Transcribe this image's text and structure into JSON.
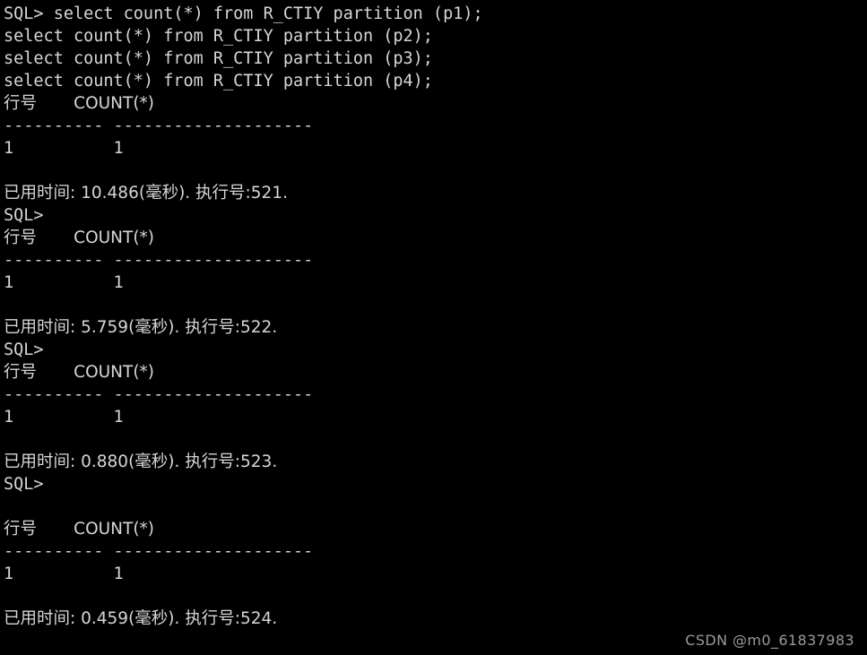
{
  "terminal": {
    "title": "SQL Terminal",
    "background_color": "#000000",
    "text_color": "#d6d6d6",
    "prompt": "SQL>",
    "lines": [
      {
        "id": "cmd-1",
        "text": "SQL> select count(*) from R_CTIY partition (p1);",
        "kind": "command"
      },
      {
        "id": "cmd-2",
        "text": "select count(*) from R_CTIY partition (p2);",
        "kind": "command"
      },
      {
        "id": "cmd-3",
        "text": "select count(*) from R_CTIY partition (p3);",
        "kind": "command"
      },
      {
        "id": "cmd-4",
        "text": "select count(*) from R_CTIY partition (p4);",
        "kind": "command"
      },
      {
        "id": "header-1",
        "text": "行号       COUNT(*)",
        "kind": "header"
      },
      {
        "id": "sep-1",
        "text": "---------- --------------------",
        "kind": "separator"
      },
      {
        "id": "row-1",
        "text": "1          1",
        "kind": "row"
      },
      {
        "id": "blank-1",
        "text": " ",
        "kind": "blank"
      },
      {
        "id": "elapsed-1",
        "text": "已用时间: 10.486(毫秒). 执行号:521.",
        "kind": "status"
      },
      {
        "id": "prompt-1",
        "text": "SQL>",
        "kind": "prompt"
      },
      {
        "id": "header-2",
        "text": "行号       COUNT(*)",
        "kind": "header"
      },
      {
        "id": "sep-2",
        "text": "---------- --------------------",
        "kind": "separator"
      },
      {
        "id": "row-2",
        "text": "1          1",
        "kind": "row"
      },
      {
        "id": "blank-2",
        "text": " ",
        "kind": "blank"
      },
      {
        "id": "elapsed-2",
        "text": "已用时间: 5.759(毫秒). 执行号:522.",
        "kind": "status"
      },
      {
        "id": "prompt-2",
        "text": "SQL>",
        "kind": "prompt"
      },
      {
        "id": "header-3",
        "text": "行号       COUNT(*)",
        "kind": "header"
      },
      {
        "id": "sep-3",
        "text": "---------- --------------------",
        "kind": "separator"
      },
      {
        "id": "row-3",
        "text": "1          1",
        "kind": "row"
      },
      {
        "id": "blank-3",
        "text": " ",
        "kind": "blank"
      },
      {
        "id": "elapsed-3",
        "text": "已用时间: 0.880(毫秒). 执行号:523.",
        "kind": "status"
      },
      {
        "id": "prompt-3",
        "text": "SQL>",
        "kind": "prompt"
      },
      {
        "id": "blank-4",
        "text": " ",
        "kind": "blank"
      },
      {
        "id": "header-4",
        "text": "行号       COUNT(*)",
        "kind": "header"
      },
      {
        "id": "sep-4",
        "text": "---------- --------------------",
        "kind": "separator"
      },
      {
        "id": "row-4",
        "text": "1          1",
        "kind": "row"
      },
      {
        "id": "blank-5",
        "text": " ",
        "kind": "blank"
      },
      {
        "id": "elapsed-4",
        "text": "已用时间: 0.459(毫秒). 执行号:524.",
        "kind": "status"
      }
    ]
  },
  "watermark": {
    "text": "CSDN @m0_61837983",
    "color": "#9a9a9a"
  }
}
